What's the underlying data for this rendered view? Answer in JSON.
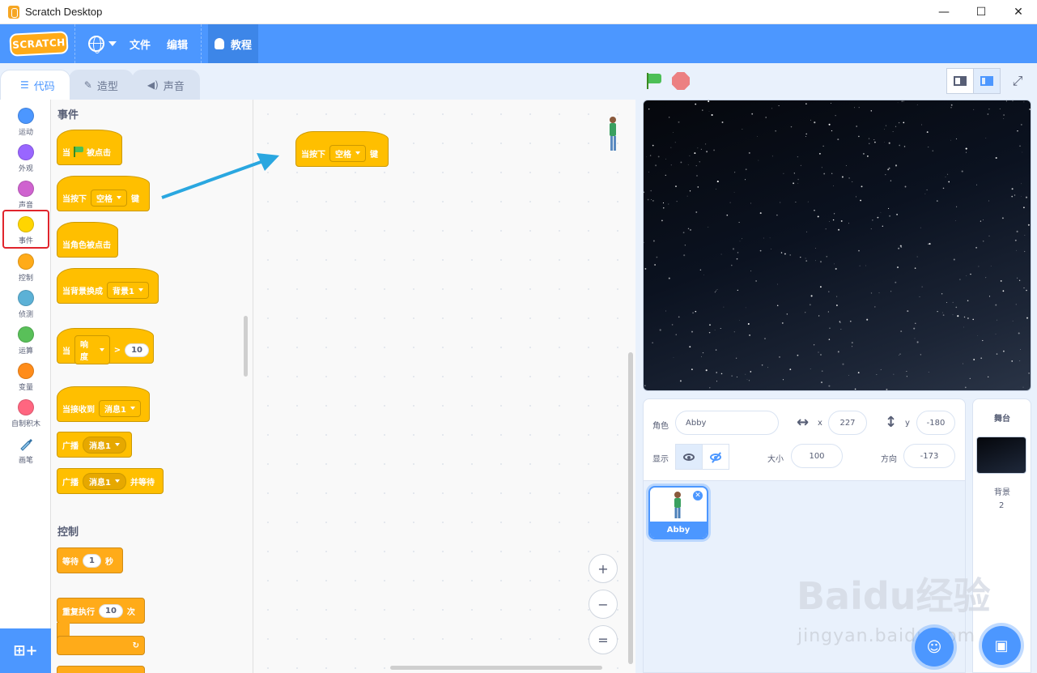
{
  "window": {
    "title": "Scratch Desktop",
    "minimize": "—",
    "maximize": "☐",
    "close": "✕"
  },
  "menubar": {
    "logo": "SCRATCH",
    "file": "文件",
    "edit": "编辑",
    "tutorials": "教程"
  },
  "tabs": [
    {
      "label": "代码",
      "icon": "code-icon",
      "active": true
    },
    {
      "label": "造型",
      "icon": "brush-icon",
      "active": false
    },
    {
      "label": "声音",
      "icon": "speaker-icon",
      "active": false
    }
  ],
  "categories": [
    {
      "label": "运动",
      "color": "#4c97ff"
    },
    {
      "label": "外观",
      "color": "#9966ff"
    },
    {
      "label": "声音",
      "color": "#cf63cf"
    },
    {
      "label": "事件",
      "color": "#ffd500",
      "selected": true
    },
    {
      "label": "控制",
      "color": "#ffab19"
    },
    {
      "label": "侦测",
      "color": "#5cb1d6"
    },
    {
      "label": "运算",
      "color": "#59c059"
    },
    {
      "label": "变量",
      "color": "#ff8c1a"
    },
    {
      "label": "自制积木",
      "color": "#ff6680"
    },
    {
      "label": "画笔",
      "color": "#0fbd8c"
    }
  ],
  "palette": {
    "events_title": "事件",
    "control_title": "控制",
    "blocks": {
      "flag_when": "当",
      "flag_clicked": "被点击",
      "key_when": "当按下",
      "key_value": "空格",
      "key_suffix": "键",
      "sprite_clicked": "当角色被点击",
      "backdrop_switch": "当背景换成",
      "backdrop_value": "背景1",
      "loudness_when": "当",
      "loudness_value": "响度",
      "gt": ">",
      "loudness_num": "10",
      "receive": "当接收到",
      "receive_value": "消息1",
      "broadcast": "广播",
      "broadcast_value": "消息1",
      "broadcast_wait": "广播",
      "broadcast_wait_value": "消息1",
      "broadcast_wait_suffix": "并等待",
      "wait": "等待",
      "wait_num": "1",
      "wait_unit": "秒",
      "repeat": "重复执行",
      "repeat_num": "10",
      "repeat_unit": "次",
      "loop_arrow": "↻"
    }
  },
  "script": {
    "key_when": "当按下",
    "key_value": "空格",
    "key_suffix": "键"
  },
  "zoom": {
    "in": "+",
    "out": "−",
    "reset": "="
  },
  "extension_button": "⊞+",
  "sprite_info": {
    "sprite_label": "角色",
    "sprite_name": "Abby",
    "x_label": "x",
    "x_value": "227",
    "y_label": "y",
    "y_value": "-180",
    "show_label": "显示",
    "size_label": "大小",
    "size_value": "100",
    "direction_label": "方向",
    "direction_value": "-173"
  },
  "sprites": [
    {
      "name": "Abby",
      "selected": true
    }
  ],
  "stage_panel": {
    "title": "舞台",
    "backdrop_label": "背景",
    "backdrop_count": "2"
  },
  "watermark": {
    "main": "Baidu经验",
    "sub": "jingyan.baidu.com"
  },
  "colors": {
    "accent": "#4c97ff",
    "events": "#ffbf00",
    "control": "#ffab19",
    "annotation_arrow": "#2aa7e0",
    "highlight": "#e0242c"
  }
}
